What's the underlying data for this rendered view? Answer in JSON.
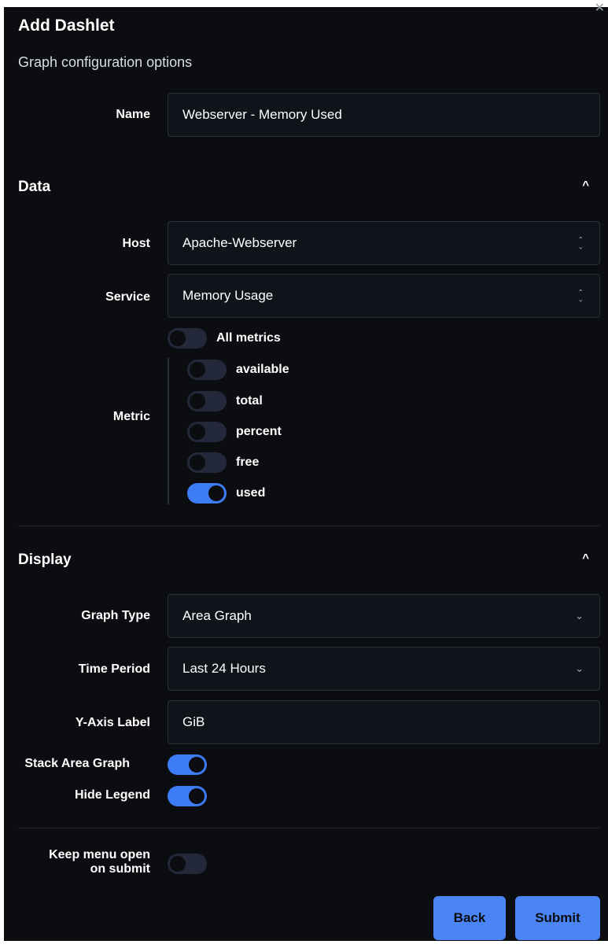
{
  "dialog": {
    "title": "Add Dashlet",
    "subtitle": "Graph configuration options",
    "close_icon": "close-icon"
  },
  "name_field": {
    "label": "Name",
    "value": "Webserver - Memory Used"
  },
  "data_section": {
    "title": "Data",
    "collapse_icon": "chevron-up-icon",
    "host": {
      "label": "Host",
      "value": "Apache-Webserver"
    },
    "service": {
      "label": "Service",
      "value": "Memory Usage"
    },
    "metric": {
      "label": "Metric",
      "all_label": "All metrics",
      "all_on": false,
      "items": [
        {
          "label": "available",
          "on": false
        },
        {
          "label": "total",
          "on": false
        },
        {
          "label": "percent",
          "on": false
        },
        {
          "label": "free",
          "on": false
        },
        {
          "label": "used",
          "on": true
        }
      ]
    }
  },
  "display_section": {
    "title": "Display",
    "collapse_icon": "chevron-up-icon",
    "graph_type": {
      "label": "Graph Type",
      "value": "Area Graph"
    },
    "time_period": {
      "label": "Time Period",
      "value": "Last 24 Hours"
    },
    "y_axis": {
      "label": "Y-Axis Label",
      "value": "GiB"
    },
    "stack": {
      "label": "Stack Area Graph",
      "on": true
    },
    "hide_legend": {
      "label": "Hide Legend",
      "on": true
    }
  },
  "footer": {
    "keep_open_line1": "Keep menu open",
    "keep_open_line2": "on submit",
    "keep_open_on": false,
    "back_label": "Back",
    "submit_label": "Submit"
  },
  "colors": {
    "accent": "#4a84f5",
    "background": "#0b0d11",
    "field": "#0f131a"
  }
}
